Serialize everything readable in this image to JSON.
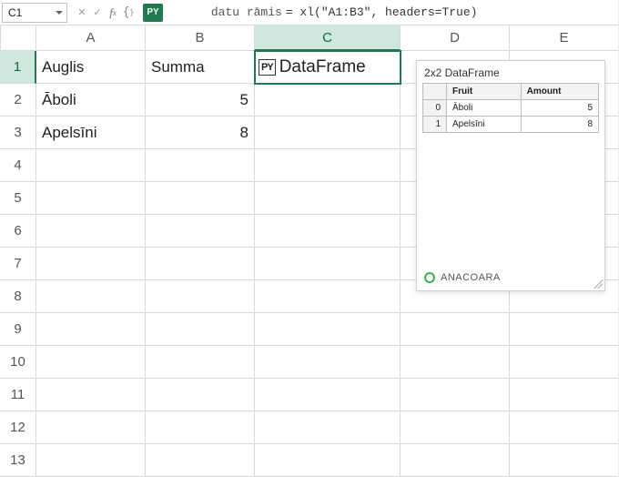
{
  "formula_bar": {
    "cell_ref": "C1",
    "py_badge": "PY",
    "variable": "datu rāmis",
    "expression": "= xl(\"A1:B3\", headers=True)"
  },
  "columns": [
    "A",
    "B",
    "C",
    "D",
    "E"
  ],
  "rows": [
    "1",
    "2",
    "3",
    "4",
    "5",
    "6",
    "7",
    "8",
    "9",
    "10",
    "11",
    "12",
    "13"
  ],
  "cells": {
    "a1": "Auglis",
    "b1": "Summa",
    "c1_badge": "PY",
    "c1_text": "DataFrame",
    "a2": "Āboli",
    "b2": "5",
    "a3": "Apelsīni",
    "b3": "8"
  },
  "preview": {
    "title": "2x2 DataFrame",
    "cols": {
      "fruit": "Fruit",
      "amount": "Amount"
    },
    "rows": [
      {
        "idx": "0",
        "fruit": "Āboli",
        "amount": "5"
      },
      {
        "idx": "1",
        "fruit": "Apelsīni",
        "amount": "8"
      }
    ],
    "footer": "ANACOARA"
  }
}
